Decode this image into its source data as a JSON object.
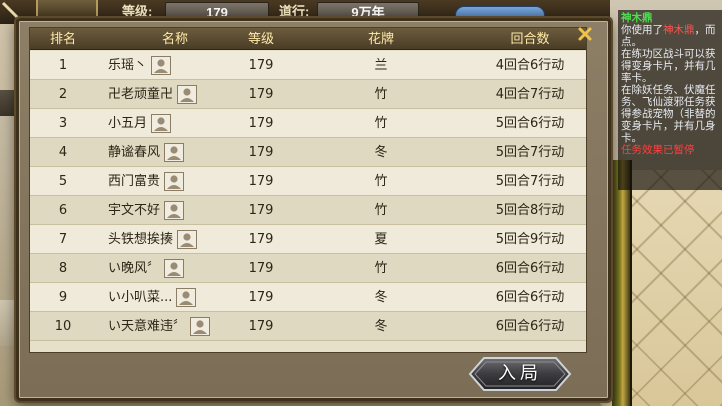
{
  "status_bar": {
    "level_label": "等级:",
    "level_value": "179",
    "daoxing_label": "道行:",
    "daoxing_value": "9万年"
  },
  "chat": {
    "speaker": "神木鼎",
    "lines": [
      {
        "pre": "你使用了",
        "hl": "神木鼎",
        "post": "，而点。"
      },
      {
        "text": "在练功区战斗可以获得变身卡片，并有几率卡。"
      },
      {
        "text": "在除妖任务、伏魔任务、飞仙渡邪任务获得参战宠物（非替的变身卡片，并有几身卡。"
      }
    ],
    "system_line": "任务效果已暂停"
  },
  "ranking": {
    "headers": {
      "rank": "排名",
      "name": "名称",
      "level": "等级",
      "flower": "花牌",
      "rounds": "回合数"
    },
    "rows": [
      {
        "rank": "1",
        "name": "乐瑶丶",
        "level": "179",
        "flower": "兰",
        "rounds": "4回合6行动"
      },
      {
        "rank": "2",
        "name": "卍老顽童卍",
        "level": "179",
        "flower": "竹",
        "rounds": "4回合7行动"
      },
      {
        "rank": "3",
        "name": "小五月",
        "level": "179",
        "flower": "竹",
        "rounds": "5回合6行动"
      },
      {
        "rank": "4",
        "name": "静谧春风",
        "level": "179",
        "flower": "冬",
        "rounds": "5回合7行动"
      },
      {
        "rank": "5",
        "name": "西门富贵",
        "level": "179",
        "flower": "竹",
        "rounds": "5回合7行动"
      },
      {
        "rank": "6",
        "name": "宇文不好",
        "level": "179",
        "flower": "竹",
        "rounds": "5回合8行动"
      },
      {
        "rank": "7",
        "name": "头铁想挨揍",
        "level": "179",
        "flower": "夏",
        "rounds": "5回合9行动"
      },
      {
        "rank": "8",
        "name": "い晚风〞",
        "level": "179",
        "flower": "竹",
        "rounds": "6回合6行动"
      },
      {
        "rank": "9",
        "name": "い小叭菜...",
        "level": "179",
        "flower": "冬",
        "rounds": "6回合6行动"
      },
      {
        "rank": "10",
        "name": "い天意难违〞",
        "level": "179",
        "flower": "冬",
        "rounds": "6回合6行动"
      }
    ],
    "enter_button": "入局",
    "row_icon": "user-avatar-icon"
  },
  "icons": {
    "close": "close-icon",
    "sword": "sword-icon"
  },
  "colors": {
    "header_text": "#ffe9a8",
    "chat_title": "#4ce04c",
    "chat_highlight": "#ff5252"
  }
}
